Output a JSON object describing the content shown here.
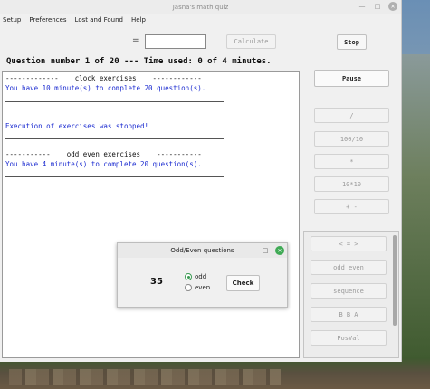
{
  "window": {
    "title": "Jasna's math quiz"
  },
  "menu": [
    "Setup",
    "Preferences",
    "Lost and Found",
    "Help"
  ],
  "toolbar": {
    "equals": "=",
    "answer_value": "",
    "calculate_label": "Calculate",
    "stop_label": "Stop"
  },
  "status_line": "Question number 1 of 20 --- Time used: 0 of 4 minutes.",
  "output": {
    "lines": [
      "-------------    clock exercises    ------------",
      "You have 10 minute(s) to complete 20 question(s).",
      "Execution of exercises was stopped!",
      "-----------    odd even exercises    -----------",
      "You have 4 minute(s) to complete 20 question(s)."
    ]
  },
  "right": {
    "pause_label": "Pause",
    "ops": [
      "/",
      "100/10",
      "*",
      "10*10",
      "+ -"
    ],
    "panel": [
      "< = >",
      "odd even",
      "sequence",
      "B B A",
      "PosVal"
    ]
  },
  "dialog": {
    "title": "Odd/Even questions",
    "number": "35",
    "option_odd": "odd",
    "option_even": "even",
    "check_label": "Check",
    "selected": "odd"
  },
  "colors": {
    "output_text_blue": "#1a2ad0",
    "accent_green": "#3a9a52"
  }
}
